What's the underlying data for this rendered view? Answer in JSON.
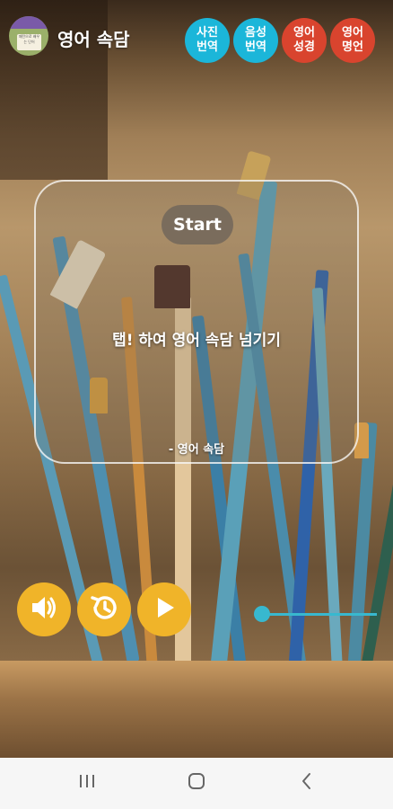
{
  "app": {
    "title": "영어 속담",
    "logo_text": "패턴으로 배우는 단어"
  },
  "top_buttons": [
    {
      "label": "사진\n번역",
      "color": "#1bb6d9"
    },
    {
      "label": "음성\n번역",
      "color": "#1bb6d9"
    },
    {
      "label": "영어\n성경",
      "color": "#d9442e"
    },
    {
      "label": "영어\n명언",
      "color": "#d9442e"
    }
  ],
  "card": {
    "start_label": "Start",
    "proverb": "탭! 하여 영어 속담 넘기기",
    "source": "- 영어 속담"
  },
  "controls": {
    "accent": "#f0b429",
    "slider_color": "#38b8cf",
    "speaker_icon": "speaker-icon",
    "history_icon": "history-icon",
    "play_icon": "play-icon",
    "slider_value": 0
  },
  "navbar": {
    "recent_icon": "recent-apps-icon",
    "home_icon": "home-icon",
    "back_icon": "back-icon"
  }
}
